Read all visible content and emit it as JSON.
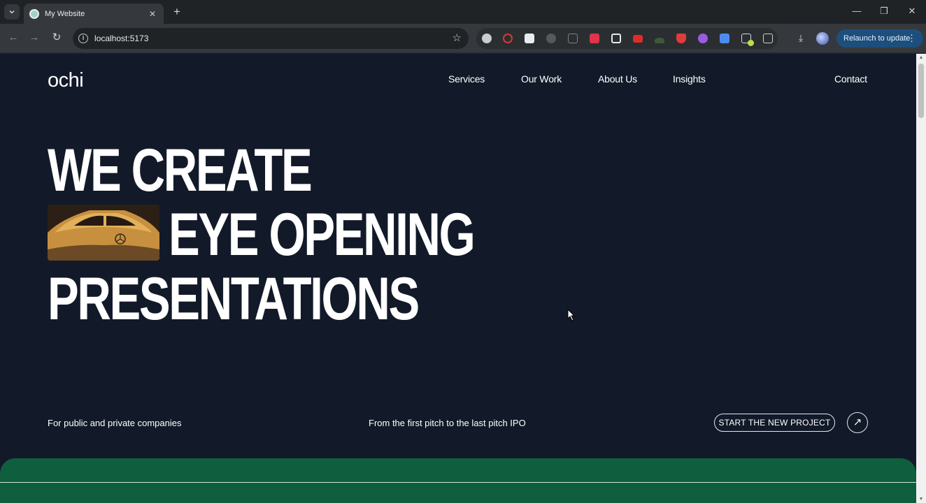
{
  "browser": {
    "tab_title": "My Website",
    "tab_close": "✕",
    "new_tab": "+",
    "url": "localhost:5173",
    "relaunch_label": "Relaunch to update",
    "window_controls": {
      "minimize": "—",
      "restore": "❐",
      "close": "✕"
    }
  },
  "site": {
    "logo": "ochi",
    "nav": [
      "Services",
      "Our Work",
      "About Us",
      "Insights"
    ],
    "contact": "Contact",
    "hero": {
      "line1": "WE CREATE",
      "line2": "EYE OPENING",
      "line3": "PRESENTATIONS"
    },
    "tagline_left": "For public and private companies",
    "tagline_mid": "From the first pitch to the last pitch IPO",
    "cta": "START THE NEW PROJECT",
    "cta_arrow": "↗"
  },
  "colors": {
    "page_bg": "#121a29",
    "marquee_bg": "#0f5e3e",
    "relaunch_bg": "#1d4f7d"
  }
}
